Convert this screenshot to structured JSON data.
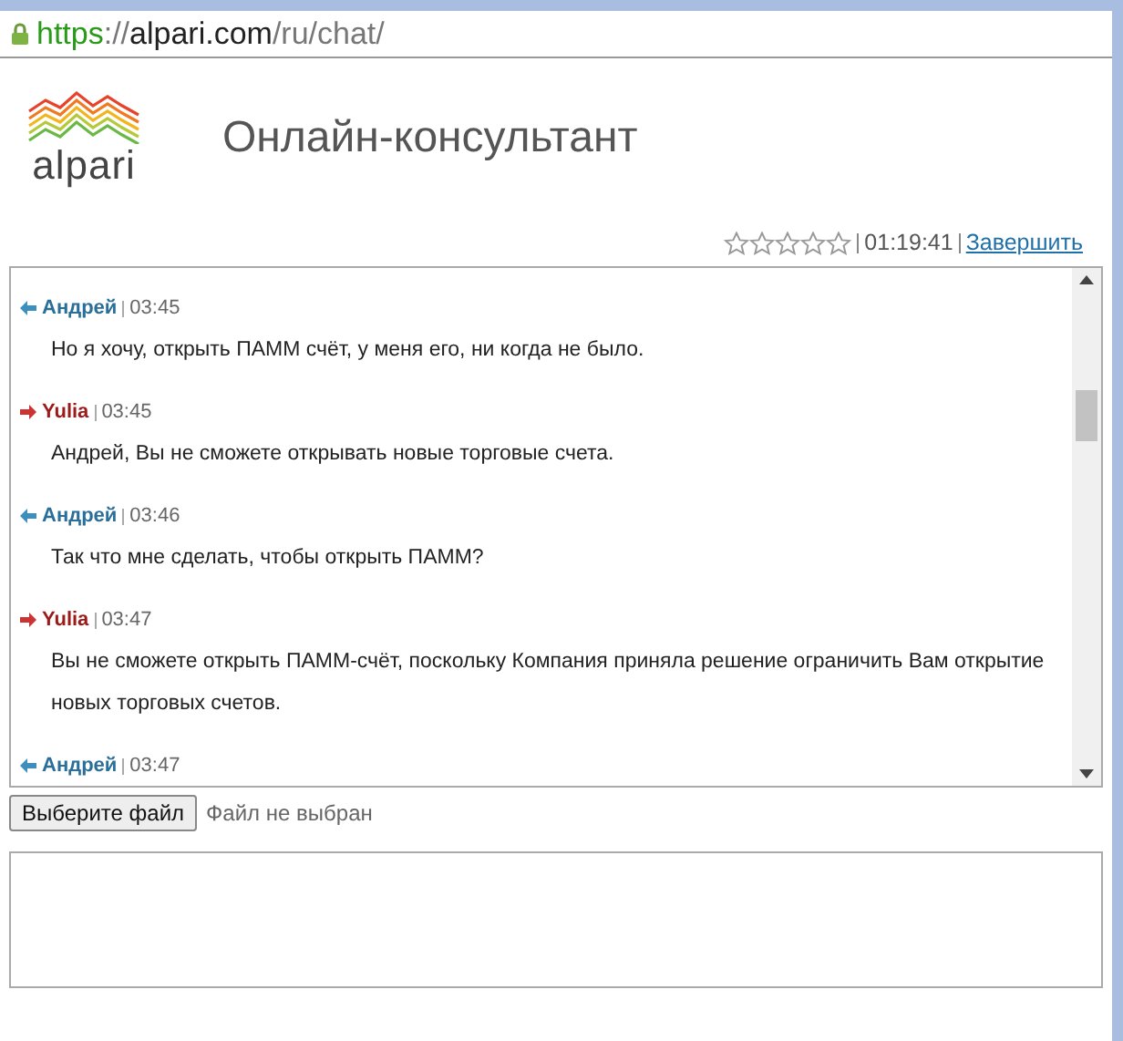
{
  "address_bar": {
    "scheme": "https",
    "separator": "://",
    "host": "alpari.com",
    "path": "/ru/chat/"
  },
  "header": {
    "logo_text": "alpari",
    "title": "Онлайн-консультант"
  },
  "session": {
    "stars": 0,
    "timer": "01:19:41",
    "end_link": "Завершить"
  },
  "messages": [
    {
      "kind": "client",
      "author": "Андрей",
      "time": "03:45",
      "text": "Но я хочу, открыть ПАММ счёт, у меня его, ни когда не было."
    },
    {
      "kind": "operator",
      "author": "Yulia",
      "time": "03:45",
      "text": "Андрей, Вы не сможете открывать новые торговые счета."
    },
    {
      "kind": "client",
      "author": "Андрей",
      "time": "03:46",
      "text": "Так что мне сделать, чтобы открыть ПАММ?"
    },
    {
      "kind": "operator",
      "author": "Yulia",
      "time": "03:47",
      "text": "Вы не сможете открыть ПАММ-счёт, поскольку Компания приняла решение ограничить Вам открытие новых торговых счетов."
    },
    {
      "kind": "client",
      "author": "Андрей",
      "time": "03:47"
    }
  ],
  "file_picker": {
    "button": "Выберите файл",
    "status": "Файл не выбран"
  }
}
